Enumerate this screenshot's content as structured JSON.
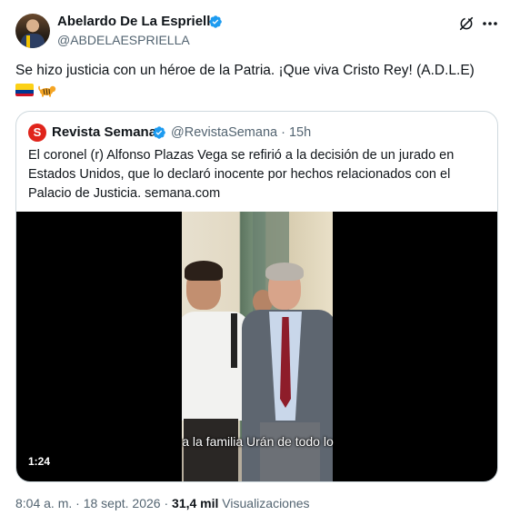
{
  "author": {
    "name": "Abelardo De La Espriella",
    "handle": "@ABDELAESPRIELLA"
  },
  "post": {
    "text": "Se hizo justicia con un héroe de la Patria. ¡Que viva Cristo Rey! (A.D.L.E)",
    "emojis": [
      "colombia-flag-emoji",
      "tiger-emoji"
    ]
  },
  "quoted": {
    "avatar_letter": "S",
    "name": "Revista Semana",
    "handle": "@RevistaSemana",
    "separator": "·",
    "time": "15h",
    "text": "El coronel (r) Alfonso Plazas Vega se refirió a la decisión de un jurado en Estados Unidos, que lo declaró inocente por hechos relacionados con el Palacio de Justicia.",
    "link": "semana.com",
    "video": {
      "subtitle": "a la familia Urán de todo lo",
      "duration": "1:24"
    }
  },
  "meta": {
    "time": "8:04 a. m.",
    "separator1": "·",
    "date": "18 sept. 2026",
    "separator2": "·",
    "views_count": "31,4 mil",
    "views_label": "Visualizaciones"
  },
  "colors": {
    "verified_blue": "#1d9bf0",
    "secondary_text": "#536471",
    "border": "#cfd9de",
    "semana_red": "#e0241b"
  }
}
